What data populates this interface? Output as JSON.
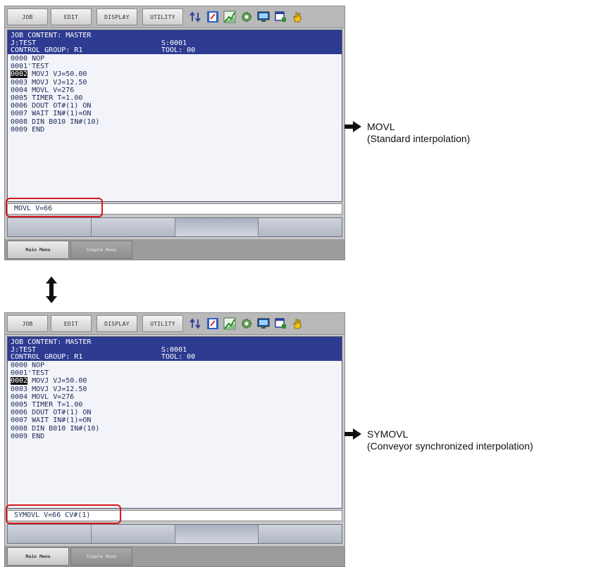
{
  "menu": {
    "job": "JOB",
    "edit": "EDIT",
    "display": "DISPLAY",
    "utility": "UTILITY"
  },
  "status_icons": [
    "mode-arrows-icon",
    "edit-doc-icon",
    "graph-icon",
    "gear-icon",
    "monitor-icon",
    "window-icon",
    "hand-icon"
  ],
  "header": {
    "line1": "JOB CONTENT: MASTER",
    "line2_left": "J:TEST",
    "line2_right": "S:0001",
    "line3_left": "CONTROL GROUP: R1",
    "line3_right": "TOOL: 00"
  },
  "job_lines": [
    {
      "num": "0000",
      "text": " NOP"
    },
    {
      "num": "0001",
      "text": "'TEST"
    },
    {
      "num": "0002",
      "text": " MOVJ VJ=50.00"
    },
    {
      "num": "0003",
      "text": " MOVJ VJ=12.50"
    },
    {
      "num": "0004",
      "text": " MOVL V=276"
    },
    {
      "num": "0005",
      "text": " TIMER T=1.00"
    },
    {
      "num": "0006",
      "text": " DOUT OT#(1) ON"
    },
    {
      "num": "0007",
      "text": " WAIT IN#(1)=ON"
    },
    {
      "num": "0008",
      "text": " DIN B010 IN#(10)"
    },
    {
      "num": "0009",
      "text": " END"
    }
  ],
  "input_top": "MOVL V=66",
  "input_bottom": "SYMOVL V=66 CV#(1)",
  "bottom_bar": {
    "main_menu": "Main Menu",
    "simple_menu": "Simple Menu"
  },
  "annotations": {
    "top": {
      "title": "MOVL",
      "subtitle": "(Standard interpolation)"
    },
    "bottom": {
      "title": "SYMOVL",
      "subtitle": "(Conveyor synchronized interpolation)"
    }
  },
  "colors": {
    "header_bg": "#2d3b91",
    "highlight": "#d8161c",
    "content_bg": "#f3f4fa"
  }
}
